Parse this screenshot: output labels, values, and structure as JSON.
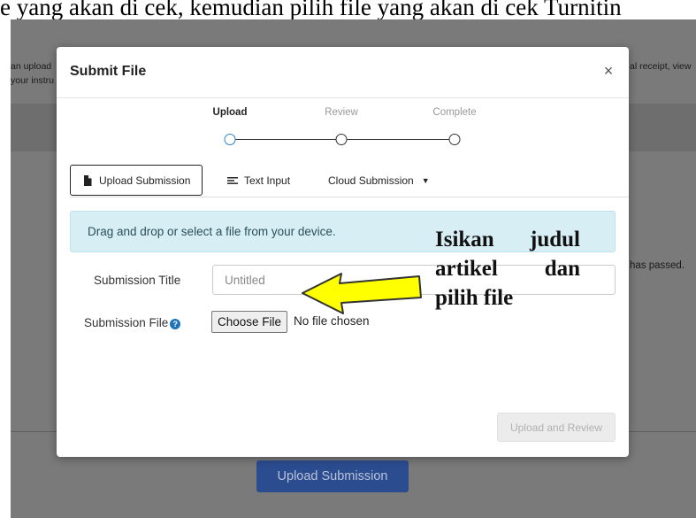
{
  "document": {
    "caption_fragment": "e yang akan di cek, kemudian pilih file yang akan di cek Turnitin"
  },
  "background_page": {
    "left_text": [
      "an upload",
      "your instru"
    ],
    "right_text": "al receipt, view",
    "right_mid_text": "has passed.",
    "upload_button_label": "Upload Submission"
  },
  "modal": {
    "title": "Submit File",
    "close_icon": "×",
    "steps": [
      {
        "label": "Upload",
        "active": true
      },
      {
        "label": "Review",
        "active": false
      },
      {
        "label": "Complete",
        "active": false
      }
    ],
    "tabs": {
      "upload_submission": "Upload Submission",
      "text_input": "Text Input",
      "cloud_submission": "Cloud Submission"
    },
    "info_message": "Drag and drop or select a file from your device.",
    "form": {
      "title_label": "Submission Title",
      "title_placeholder": "Untitled",
      "file_label": "Submission File",
      "choose_file_button": "Choose File",
      "no_file_text": "No file chosen"
    },
    "upload_review_button": "Upload and Review"
  },
  "annotation": {
    "lines": [
      [
        "Isikan",
        "judul"
      ],
      [
        "artikel",
        "dan"
      ],
      [
        "pilih file"
      ]
    ],
    "arrow_color": "#ffff00"
  },
  "colors": {
    "active_step": "#2d7fc9",
    "info_bg": "#d7eef4",
    "help_icon": "#1f73b7",
    "overlay": "#7a7a7a"
  }
}
